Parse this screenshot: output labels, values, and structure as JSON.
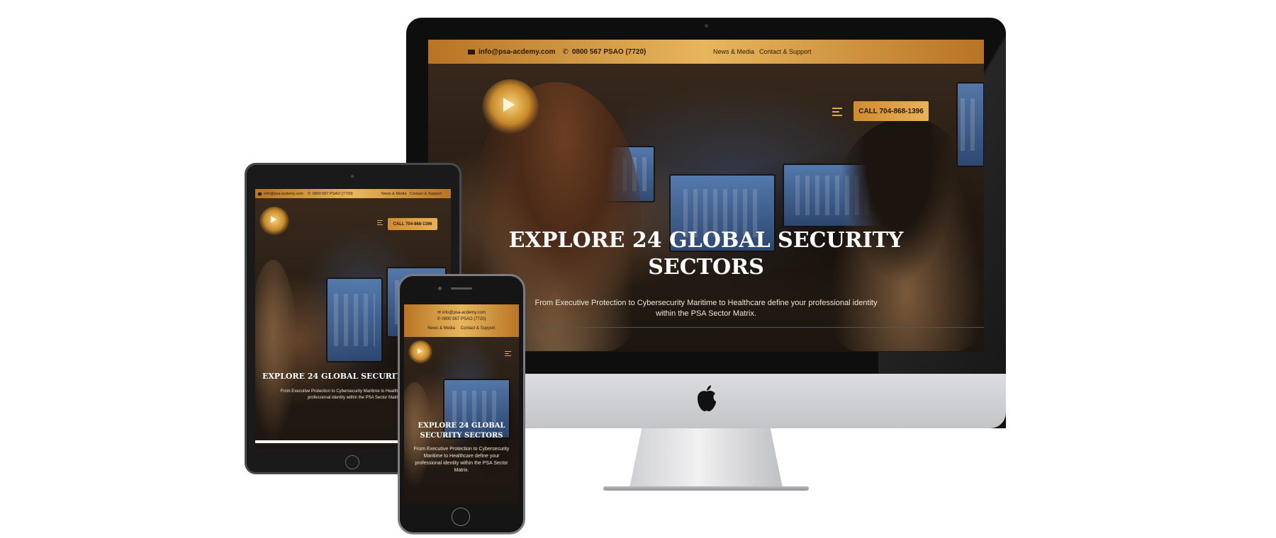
{
  "site": {
    "email": "info@psa-acdemy.com",
    "phone": "0800 567 PSAO (7720)",
    "nav_news": "News & Media",
    "nav_contact": "Contact & Support",
    "call_label": "CALL 704-868-1396",
    "hero_title": "EXPLORE 24 GLOBAL SECURITY SECTORS",
    "hero_title_line1": "EXPLORE 24 GLOBAL SECURITY",
    "hero_title_line2": "SECTORS",
    "hero_title_phone_line1": "EXPLORE 24 GLOBAL",
    "hero_title_phone_line2": "SECURITY SECTORS",
    "hero_subtitle": "From Executive Protection to Cybersecurity Maritime to Healthcare define your professional identity within the PSA Sector Matrix.",
    "hero_sub_line1": "From Executive Protection to Cybersecurity Maritime to Healthcare define your professional identity",
    "hero_sub_line2": "within the PSA Sector Matrix.",
    "tablet_sub_line1": "From Executive Protection to Cybersecurity Maritime to Healthcare define your",
    "tablet_sub_line2": "professional identity within the PSA Sector Matrix.",
    "tablet_title": "EXPLORE 24 GLOBAL SECURITY SECTORS",
    "phone_sub": "From Executive Protection to Cybersecurity Maritime to Healthcare define your professional identity within the PSA Sector Matrix."
  },
  "devices": {
    "desktop": "imac",
    "tablet": "ipad",
    "phone": "iphone"
  },
  "icons": {
    "mail": "mail-icon",
    "phone": "phone-icon",
    "menu": "hamburger-icon",
    "brand": "apple-logo-icon",
    "academy": "academy-logo-icon"
  },
  "colors": {
    "gold_dark": "#b87423",
    "gold_light": "#e7b65d",
    "button": "#d08b2e"
  }
}
